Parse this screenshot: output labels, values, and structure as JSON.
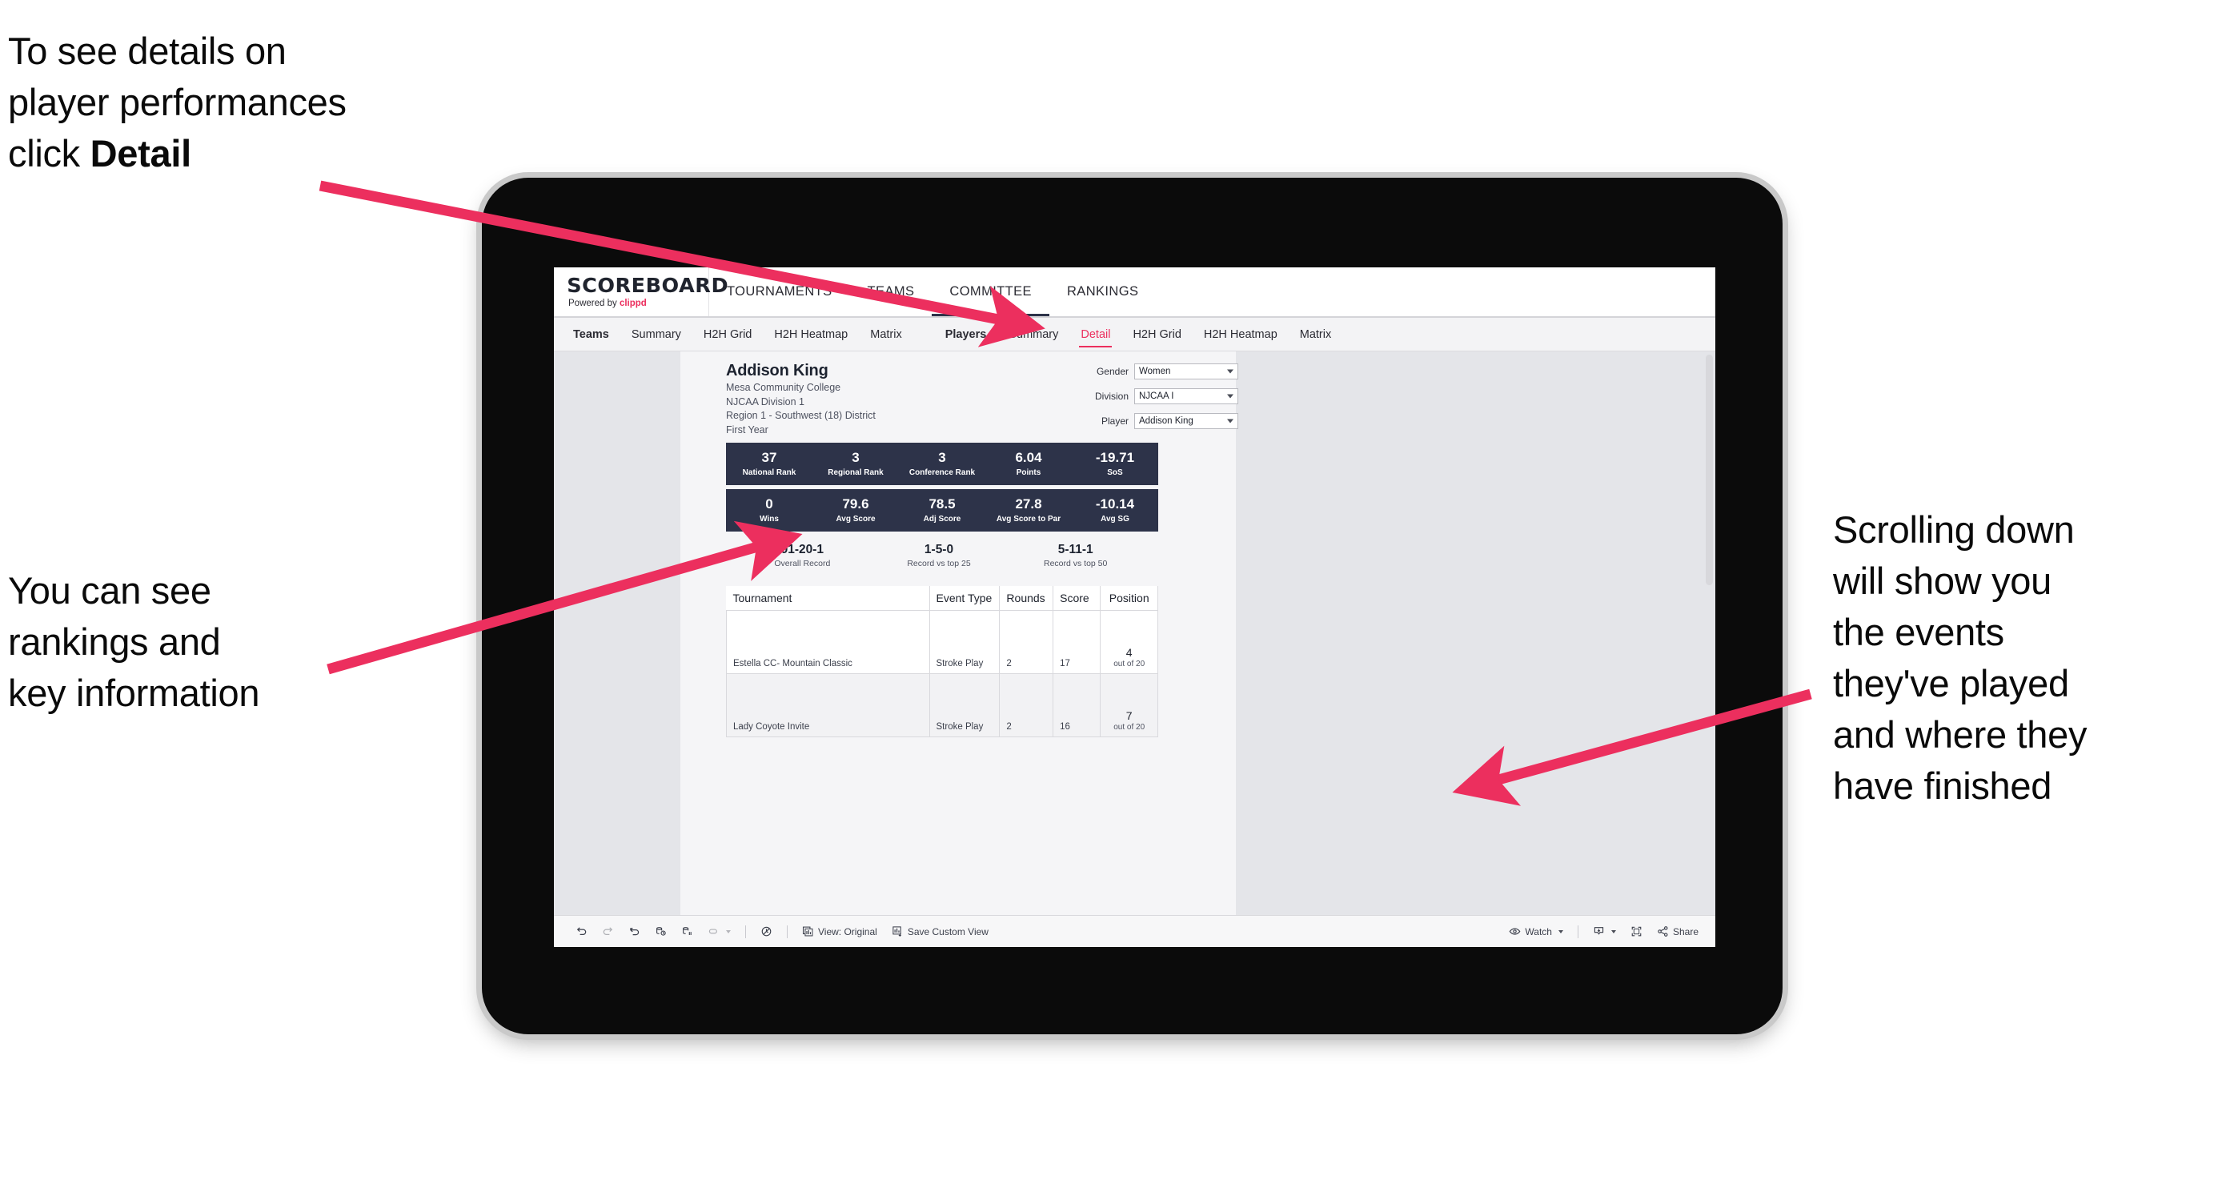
{
  "annotations": {
    "detail": "To see details on\nplayer performances\nclick ",
    "detail_bold": "Detail",
    "rankings": "You can see\nrankings and\nkey information",
    "scrolling": "Scrolling down\nwill show you\nthe events\nthey've played\nand where they\nhave finished"
  },
  "colors": {
    "accent_pink": "#ec2f5e",
    "navy": "#2d3349",
    "screen_bg": "#e4e5e9",
    "sheet_bg": "#f5f5f7"
  },
  "app": {
    "brand": {
      "title": "SCOREBOARD",
      "powered_prefix": "Powered by ",
      "powered_name": "clippd"
    },
    "nav": [
      {
        "label": "TOURNAMENTS",
        "active": false
      },
      {
        "label": "TEAMS",
        "active": false
      },
      {
        "label": "COMMITTEE",
        "active": true
      },
      {
        "label": "RANKINGS",
        "active": false
      }
    ],
    "tabs_teams": [
      {
        "label": "Teams",
        "lead": true,
        "active": false
      },
      {
        "label": "Summary",
        "lead": false,
        "active": false
      },
      {
        "label": "H2H Grid",
        "lead": false,
        "active": false
      },
      {
        "label": "H2H Heatmap",
        "lead": false,
        "active": false
      },
      {
        "label": "Matrix",
        "lead": false,
        "active": false
      }
    ],
    "tabs_players": [
      {
        "label": "Players",
        "lead": true,
        "active": false
      },
      {
        "label": "Summary",
        "lead": false,
        "active": false
      },
      {
        "label": "Detail",
        "lead": false,
        "active": true
      },
      {
        "label": "H2H Grid",
        "lead": false,
        "active": false
      },
      {
        "label": "H2H Heatmap",
        "lead": false,
        "active": false
      },
      {
        "label": "Matrix",
        "lead": false,
        "active": false
      }
    ]
  },
  "player": {
    "name": "Addison King",
    "school": "Mesa Community College",
    "division": "NJCAA Division 1",
    "region": "Region 1 - Southwest (18) District",
    "year": "First Year"
  },
  "filters": [
    {
      "label": "Gender",
      "value": "Women"
    },
    {
      "label": "Division",
      "value": "NJCAA I"
    },
    {
      "label": "Player",
      "value": "Addison King"
    }
  ],
  "stats_row1": [
    {
      "value": "37",
      "label": "National Rank"
    },
    {
      "value": "3",
      "label": "Regional Rank"
    },
    {
      "value": "3",
      "label": "Conference Rank"
    },
    {
      "value": "6.04",
      "label": "Points"
    },
    {
      "value": "-19.71",
      "label": "SoS"
    }
  ],
  "stats_row2": [
    {
      "value": "0",
      "label": "Wins"
    },
    {
      "value": "79.6",
      "label": "Avg Score"
    },
    {
      "value": "78.5",
      "label": "Adj Score"
    },
    {
      "value": "27.8",
      "label": "Avg Score to Par"
    },
    {
      "value": "-10.14",
      "label": "Avg SG"
    }
  ],
  "records": [
    {
      "value": "91-20-1",
      "label": "Overall Record"
    },
    {
      "value": "1-5-0",
      "label": "Record vs top 25"
    },
    {
      "value": "5-11-1",
      "label": "Record vs top 50"
    }
  ],
  "events_table": {
    "columns": [
      "Tournament",
      "Event Type",
      "Rounds",
      "Score",
      "Position"
    ],
    "rows": [
      {
        "tournament": "Estella CC- Mountain Classic",
        "event_type": "Stroke Play",
        "rounds": "2",
        "score": "17",
        "position": "4",
        "position_sub": "out of 20"
      },
      {
        "tournament": "Lady Coyote Invite",
        "event_type": "Stroke Play",
        "rounds": "2",
        "score": "16",
        "position": "7",
        "position_sub": "out of 20"
      }
    ]
  },
  "statusbar": {
    "view_label": "View: Original",
    "save_label": "Save Custom View",
    "watch_label": "Watch",
    "share_label": "Share"
  }
}
